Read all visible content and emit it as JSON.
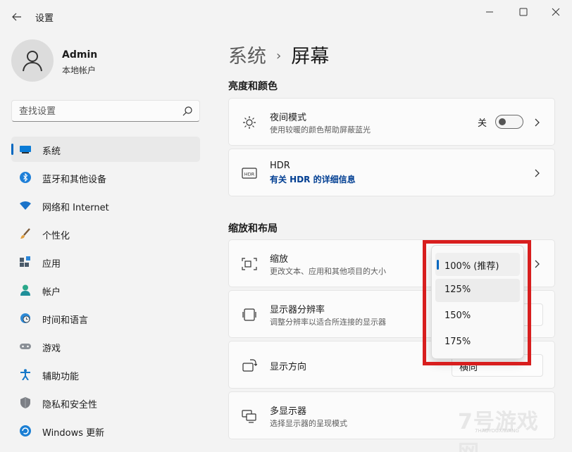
{
  "window": {
    "title": "设置"
  },
  "profile": {
    "name": "Admin",
    "account_type": "本地帐户"
  },
  "search": {
    "placeholder": "查找设置"
  },
  "nav": [
    {
      "label": "系统",
      "icon": "monitor-icon",
      "active": true
    },
    {
      "label": "蓝牙和其他设备",
      "icon": "bluetooth-icon"
    },
    {
      "label": "网络和 Internet",
      "icon": "wifi-icon"
    },
    {
      "label": "个性化",
      "icon": "brush-icon"
    },
    {
      "label": "应用",
      "icon": "apps-icon"
    },
    {
      "label": "帐户",
      "icon": "person-icon"
    },
    {
      "label": "时间和语言",
      "icon": "globe-clock-icon"
    },
    {
      "label": "游戏",
      "icon": "gamepad-icon"
    },
    {
      "label": "辅助功能",
      "icon": "accessibility-icon"
    },
    {
      "label": "隐私和安全性",
      "icon": "shield-icon"
    },
    {
      "label": "Windows 更新",
      "icon": "update-icon"
    }
  ],
  "breadcrumb": {
    "parent": "系统",
    "separator": "›",
    "current": "屏幕"
  },
  "sections": {
    "brightness_color": "亮度和颜色",
    "scale_layout": "缩放和布局"
  },
  "cards": {
    "night_light": {
      "title": "夜间模式",
      "subtitle": "使用较暖的颜色帮助屏蔽蓝光",
      "toggle_state": "关"
    },
    "hdr": {
      "title": "HDR",
      "link": "有关 HDR 的详细信息"
    },
    "scale": {
      "title": "缩放",
      "subtitle": "更改文本、应用和其他项目的大小"
    },
    "resolution": {
      "title": "显示器分辨率",
      "subtitle": "调整分辨率以适合所连接的显示器"
    },
    "orientation": {
      "title": "显示方向",
      "value": "横向"
    },
    "multi_display": {
      "title": "多显示器",
      "subtitle": "选择显示器的呈现模式"
    }
  },
  "scale_dropdown": {
    "options": [
      "100% (推荐)",
      "125%",
      "150%",
      "175%"
    ],
    "selected": "100% (推荐)"
  },
  "watermark": {
    "text": "7号游戏网",
    "subtext": "7HAOYOUXIWANG"
  },
  "colors": {
    "accent": "#0067c0",
    "highlight_border": "#d81e1e",
    "link": "#003e92"
  }
}
